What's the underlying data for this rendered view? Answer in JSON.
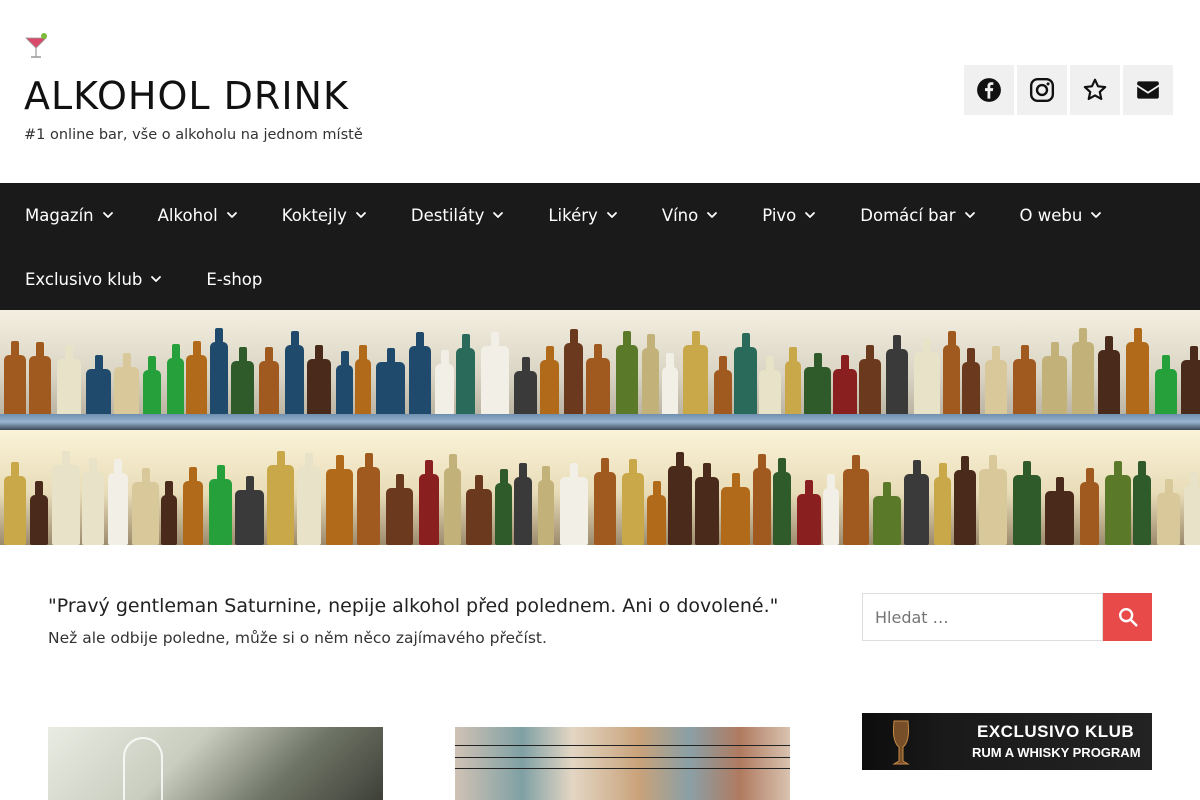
{
  "header": {
    "site_title": "ALKOHOL DRINK",
    "tagline": "#1 online bar, vše o alkoholu na jednom místě",
    "logo_icon": "cocktail-glass-icon",
    "social": [
      {
        "icon": "facebook-icon"
      },
      {
        "icon": "instagram-icon"
      },
      {
        "icon": "star-icon"
      },
      {
        "icon": "envelope-icon"
      }
    ]
  },
  "nav": {
    "items": [
      {
        "label": "Magazín",
        "dropdown": true
      },
      {
        "label": "Alkohol",
        "dropdown": true
      },
      {
        "label": "Koktejly",
        "dropdown": true
      },
      {
        "label": "Destiláty",
        "dropdown": true
      },
      {
        "label": "Likéry",
        "dropdown": true
      },
      {
        "label": "Víno",
        "dropdown": true
      },
      {
        "label": "Pivo",
        "dropdown": true
      },
      {
        "label": "Domácí bar",
        "dropdown": true
      },
      {
        "label": "O webu",
        "dropdown": true
      },
      {
        "label": "Exclusivo klub",
        "dropdown": true
      },
      {
        "label": "E-shop",
        "dropdown": false
      }
    ]
  },
  "main": {
    "quote": "\"Pravý gentleman Saturnine, nepije alkohol před polednem. Ani o dovolené.\"",
    "subquote": "Než ale odbije poledne, může si o něm něco zajímavého přečíst."
  },
  "sidebar": {
    "search_placeholder": "Hledat …",
    "search_icon": "search-icon",
    "banner": {
      "line1": "EXCLUSIVO KLUB",
      "line2": "RUM A WHISKY PROGRAM"
    }
  },
  "colors": {
    "nav_bg": "#1a1a1a",
    "accent": "#e84a4a",
    "social_bg": "#f0f0f0"
  }
}
